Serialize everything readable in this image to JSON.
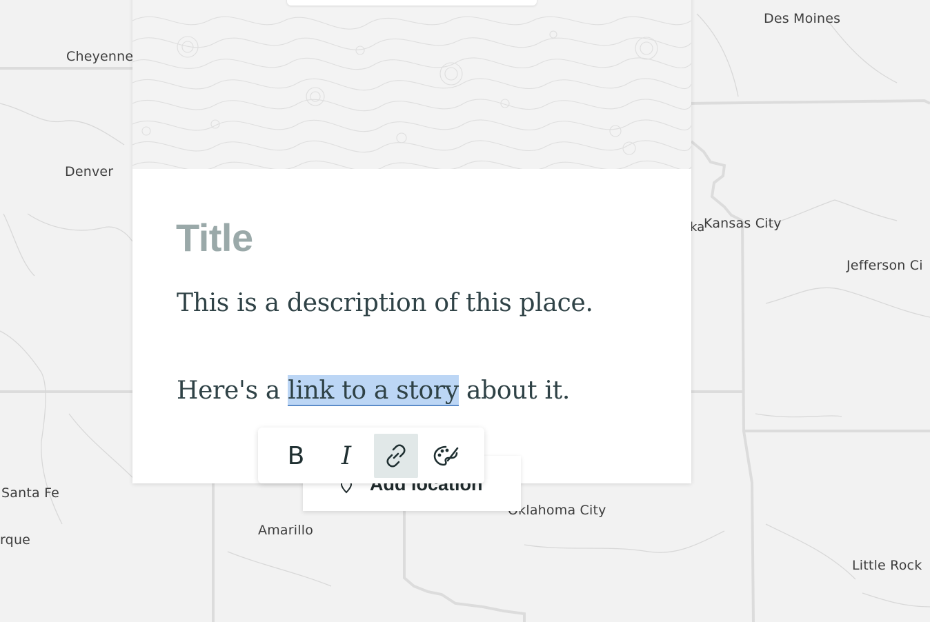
{
  "map": {
    "cities": [
      {
        "key": "des_moines",
        "label": "Des Moines"
      },
      {
        "key": "cheyenne",
        "label": "Cheyenne"
      },
      {
        "key": "denver",
        "label": "Denver"
      },
      {
        "key": "topeka_fragment",
        "label": "ka"
      },
      {
        "key": "kansas_city",
        "label": "Kansas City"
      },
      {
        "key": "jefferson_city",
        "label": "Jefferson Ci"
      },
      {
        "key": "santa_fe",
        "label": "Santa Fe"
      },
      {
        "key": "albuquerque_fragment",
        "label": "rque"
      },
      {
        "key": "amarillo",
        "label": "Amarillo"
      },
      {
        "key": "oklahoma_city",
        "label": "Oklahoma City"
      },
      {
        "key": "little_rock",
        "label": "Little Rock"
      }
    ]
  },
  "card": {
    "title": "Title",
    "paragraph1": "This is a description of this place.",
    "paragraph2_before": "Here's a ",
    "paragraph2_link": "link to a story",
    "paragraph2_after": " about it."
  },
  "toolbar": {
    "bold_label": "B",
    "italic_label": "I",
    "link_icon": "link-icon",
    "style_icon": "palette-icon",
    "active_tool": "link"
  },
  "add_location": {
    "label": "Add location",
    "icon": "map-pin-icon"
  },
  "colors": {
    "selection": "#bcd6f5",
    "text": "#2f4246",
    "title_placeholder": "#9aa9a9",
    "map_bg": "#f2f2f2",
    "map_borders": "#dcdcdc"
  }
}
